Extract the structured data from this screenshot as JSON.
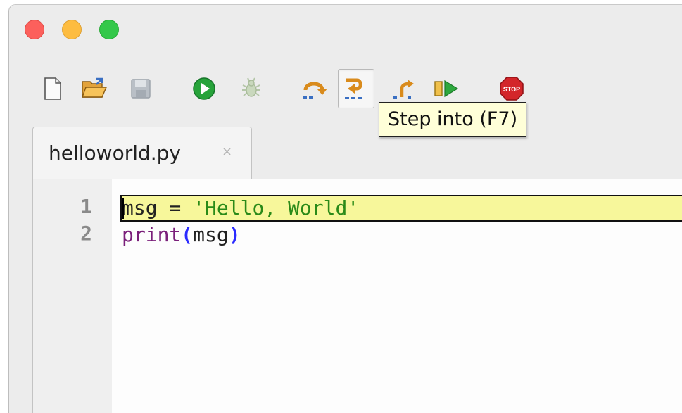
{
  "window": {
    "traffic_lights": [
      "close",
      "minimize",
      "zoom"
    ]
  },
  "toolbar": {
    "buttons": [
      {
        "name": "new-file",
        "icon": "new-document-icon",
        "enabled": true
      },
      {
        "name": "open-file",
        "icon": "open-folder-icon",
        "enabled": true
      },
      {
        "name": "save-file",
        "icon": "save-disk-icon",
        "enabled": false
      },
      {
        "name": "run",
        "icon": "play-icon",
        "enabled": true
      },
      {
        "name": "debug",
        "icon": "bug-icon",
        "enabled": false
      },
      {
        "name": "step-over",
        "icon": "step-over-icon",
        "enabled": true
      },
      {
        "name": "step-into",
        "icon": "step-into-icon",
        "enabled": true,
        "pressed": true
      },
      {
        "name": "step-out",
        "icon": "step-out-icon",
        "enabled": true
      },
      {
        "name": "resume",
        "icon": "resume-icon",
        "enabled": true
      },
      {
        "name": "stop",
        "icon": "stop-sign-icon",
        "enabled": true,
        "label": "STOP"
      }
    ]
  },
  "tooltip": {
    "text": "Step into (F7)"
  },
  "tabs": [
    {
      "label": "helloworld.py",
      "close_glyph": "×",
      "active": true
    }
  ],
  "editor": {
    "line_numbers": [
      "1",
      "2"
    ],
    "current_line": 1,
    "lines": [
      {
        "tokens": [
          {
            "text": "msg",
            "kind": "name"
          },
          {
            "text": " = ",
            "kind": "op"
          },
          {
            "text": "'Hello, World'",
            "kind": "str"
          }
        ]
      },
      {
        "tokens": [
          {
            "text": "print",
            "kind": "fn"
          },
          {
            "text": "(",
            "kind": "paren"
          },
          {
            "text": "msg",
            "kind": "name"
          },
          {
            "text": ")",
            "kind": "paren"
          }
        ]
      }
    ]
  },
  "colors": {
    "current_line_bg": "#f7f79b",
    "string": "#2a8a18",
    "builtin": "#7a1f7a",
    "paren": "#2b2bff",
    "tooltip_bg": "#ffffd8"
  }
}
